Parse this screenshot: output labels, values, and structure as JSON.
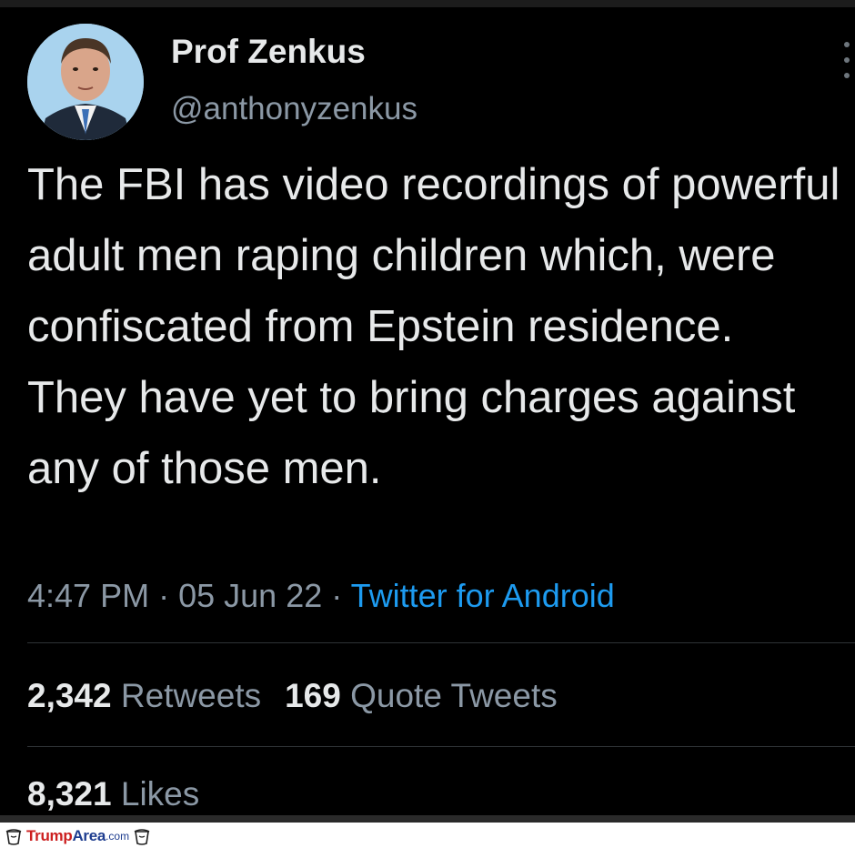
{
  "tweet": {
    "author": {
      "display_name": "Prof Zenkus",
      "handle": "@anthonyzenkus",
      "avatar": "profile-photo"
    },
    "text": "The FBI has video recordings of powerful adult men raping children which, were confiscated from Epstein residence. They have yet to bring charges against any of those men.",
    "time": "4:47 PM",
    "date": "05 Jun 22",
    "separator": "·",
    "source": "Twitter for Android",
    "stats": {
      "retweets_count": "2,342",
      "retweets_label": "Retweets",
      "quote_count": "169",
      "quote_label": "Quote Tweets",
      "likes_count": "8,321",
      "likes_label": "Likes"
    },
    "menu_icon": "more-vertical-icon"
  },
  "watermark": {
    "brand_part1": "Trump",
    "brand_part2": "Area",
    "tld": ".com"
  },
  "colors": {
    "background": "#000000",
    "text": "#e7e9ea",
    "muted": "#8b98a5",
    "link": "#1d9bf0",
    "divider": "#2f3336"
  }
}
